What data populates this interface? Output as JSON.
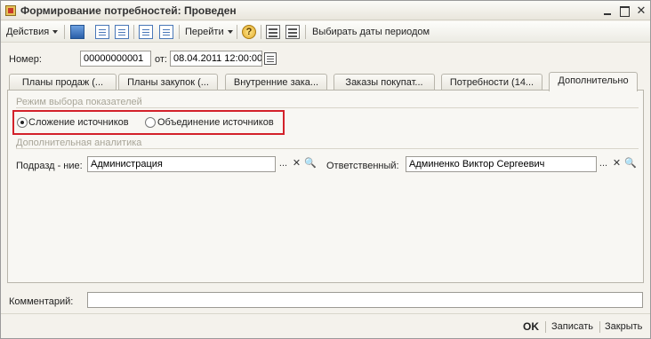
{
  "window": {
    "title": "Формирование потребностей: Проведен"
  },
  "toolbar": {
    "actions_label": "Действия",
    "goto_label": "Перейти",
    "help_glyph": "?",
    "select_dates_label": "Выбирать даты периодом"
  },
  "header": {
    "number_label": "Номер:",
    "number_value": "00000000001",
    "date_label": "от:",
    "date_value": "08.04.2011 12:00:00"
  },
  "tabs": [
    {
      "label": "Планы продаж (...",
      "active": false
    },
    {
      "label": "Планы закупок (...",
      "active": false
    },
    {
      "label": "Внутренние зака...",
      "active": false
    },
    {
      "label": "Заказы покупат...",
      "active": false
    },
    {
      "label": "Потребности (14...",
      "active": false
    },
    {
      "label": "Дополнительно",
      "active": true
    }
  ],
  "panel": {
    "mode_group_title": "Режим выбора показателей",
    "radio_sum_label": "Сложение источников",
    "radio_union_label": "Объединение источников",
    "radio_selected": "sum",
    "analytics_group_title": "Дополнительная аналитика",
    "department_label": "Подразд - ние:",
    "department_value": "Администрация",
    "responsible_label": "Ответственный:",
    "responsible_value": "Админенко Виктор Сергеевич",
    "select_glyph": "...",
    "clear_glyph": "✕",
    "search_glyph": "🔍"
  },
  "comment": {
    "label": "Комментарий:",
    "value": ""
  },
  "bottom": {
    "ok_label": "OK",
    "save_label": "Записать",
    "close_label": "Закрыть"
  },
  "colors": {
    "highlight_border": "#d3212a",
    "group_title": "#a8a598"
  }
}
